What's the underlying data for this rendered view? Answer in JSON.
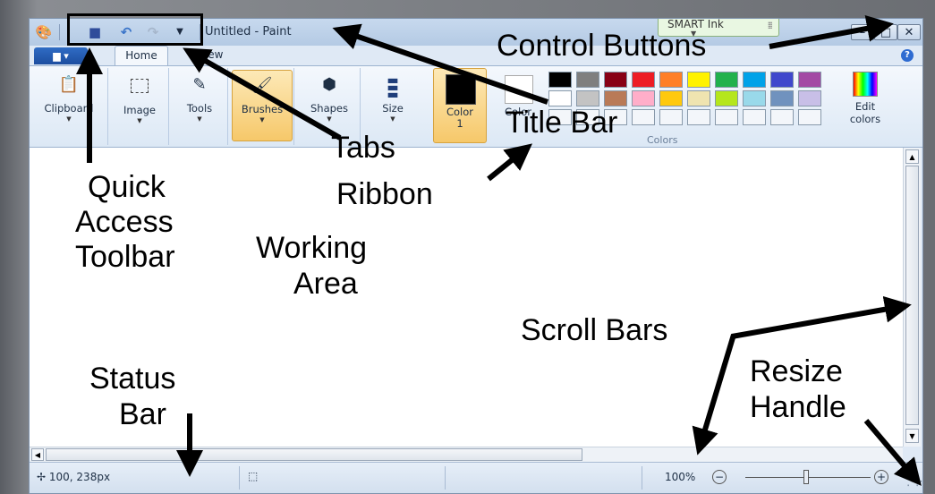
{
  "window": {
    "title": "Untitled - Paint",
    "smart_ink_label": "SMART Ink",
    "control_buttons": {
      "minimize": "–",
      "maximize": "□",
      "close": "✕"
    }
  },
  "quick_access": {
    "icons": [
      "paint-app-icon",
      "save-icon",
      "undo-icon",
      "redo-icon",
      "dropdown-icon"
    ]
  },
  "tabs": {
    "paint_menu": "▆ ▾",
    "home": "Home",
    "view": "View"
  },
  "ribbon": {
    "clipboard": "Clipboard",
    "image": "Image",
    "tools": "Tools",
    "brushes": "Brushes",
    "shapes": "Shapes",
    "size": "Size",
    "color1": "Color\n1",
    "color2": "Color",
    "colors_group": "Colors",
    "edit_colors": "Edit\ncolors",
    "palette_row1": [
      "#000000",
      "#7f7f7f",
      "#880015",
      "#ed1c24",
      "#ff7f27",
      "#fff200",
      "#22b14c",
      "#00a2e8",
      "#3f48cc",
      "#a349a4"
    ],
    "palette_row2": [
      "#ffffff",
      "#c3c3c3",
      "#b97a57",
      "#ffaec9",
      "#ffc90e",
      "#efe4b0",
      "#b5e61d",
      "#99d9ea",
      "#7092be",
      "#c8bfe7"
    ]
  },
  "status": {
    "position": "100, 238px",
    "zoom": "100%"
  },
  "annotations": {
    "control_buttons": "Control Buttons",
    "title_bar": "Title Bar",
    "tabs": "Tabs",
    "ribbon": "Ribbon",
    "quick_access_1": "Quick",
    "quick_access_2": "Access",
    "quick_access_3": "Toolbar",
    "working_area_1": "Working",
    "working_area_2": "Area",
    "scroll_bars": "Scroll Bars",
    "status_bar_1": "Status",
    "status_bar_2": "Bar",
    "resize_handle_1": "Resize",
    "resize_handle_2": "Handle"
  }
}
